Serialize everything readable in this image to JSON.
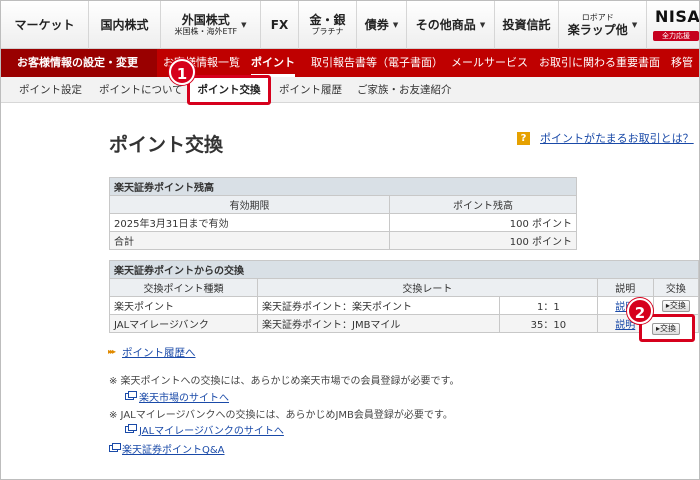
{
  "topnav": {
    "items": [
      {
        "label": "マーケット"
      },
      {
        "label": "国内株式"
      },
      {
        "label": "外国株式",
        "sub": "米国株・海外ETF",
        "dropdown": true
      },
      {
        "label": "FX"
      },
      {
        "label": "金・銀",
        "sub": "プラチナ"
      },
      {
        "label": "債券",
        "dropdown": true
      },
      {
        "label": "その他商品",
        "dropdown": true
      },
      {
        "label": "投資信託"
      },
      {
        "label": "楽ラップ他",
        "sub": "ロボアド",
        "dropdown": true
      }
    ],
    "nisa": "NISA",
    "nisa_sub": "全力応援"
  },
  "redbar": {
    "section": "お客様情報の設定・変更",
    "items": [
      "お客様情報一覧",
      "ポイント",
      "取引報告書等（電子書面）",
      "メールサービス",
      "お取引に関わる重要書面",
      "移管"
    ],
    "active_index": 1
  },
  "subnav": {
    "items": [
      "ポイント設定",
      "ポイントについて",
      "ポイント交換",
      "ポイント履歴",
      "ご家族・お友達紹介"
    ],
    "active_index": 2
  },
  "badges": [
    "1",
    "2"
  ],
  "page": {
    "title": "ポイント交換",
    "help_mark": "?",
    "help_link": "ポイントがたまるお取引とは？"
  },
  "balance": {
    "caption": "楽天証券ポイント残高",
    "headers": [
      "有効期限",
      "ポイント残高"
    ],
    "rows": [
      [
        "2025年3月31日まで有効",
        "100 ポイント"
      ],
      [
        "合計",
        "100 ポイント"
      ]
    ]
  },
  "exchange": {
    "caption": "楽天証券ポイントからの交換",
    "headers": [
      "交換ポイント種類",
      "交換レート",
      "説明",
      "交換"
    ],
    "rows": [
      {
        "kind": "楽天ポイント",
        "rate_label": "楽天証券ポイント：楽天ポイント",
        "rate": "1：1",
        "desc": "説明",
        "button": "▸交換"
      },
      {
        "kind": "JALマイレージバンク",
        "rate_label": "楽天証券ポイント：JMBマイル",
        "rate": "35：10",
        "desc": "説明",
        "button": "▸交換"
      }
    ]
  },
  "links": {
    "history": "ポイント履歴へ",
    "arrow": "▸▸▸"
  },
  "notes": [
    {
      "text": "※ 楽天ポイントへの交換には、あらかじめ楽天市場での会員登録が必要です。",
      "link": "楽天市場のサイトへ"
    },
    {
      "text": "※ JALマイレージバンクへの交換には、あらかじめJMB会員登録が必要です。",
      "link": "JALマイレージバンクのサイトへ"
    }
  ],
  "faq_link": "楽天証券ポイントQ&A",
  "colors": {
    "brand_red": "#bf0000",
    "highlight_red": "#d6001c",
    "link_blue": "#1a4aa8"
  }
}
